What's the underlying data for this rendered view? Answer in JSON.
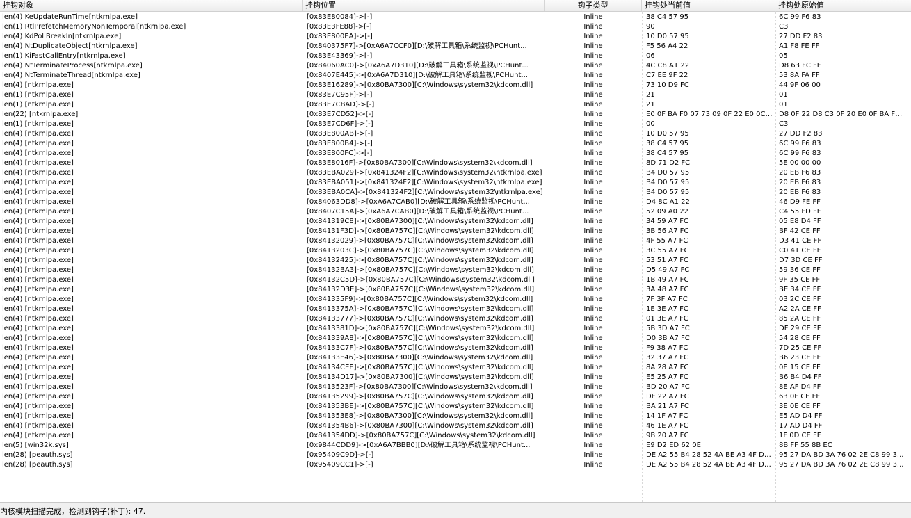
{
  "columns": [
    "挂钩对象",
    "挂钩位置",
    "钩子类型",
    "挂钩处当前值",
    "挂钩处原始值"
  ],
  "rows": [
    [
      "len(4) KeUpdateRunTime[ntkrnlpa.exe]",
      "[0x83E80084]->[-]",
      "Inline",
      "38 C4 57 95",
      "6C 99 F6 83"
    ],
    [
      "len(1) RtlPrefetchMemoryNonTemporal[ntkrnlpa.exe]",
      "[0x83E3FE88]->[-]",
      "Inline",
      "90",
      "C3"
    ],
    [
      "len(4) KdPollBreakIn[ntkrnlpa.exe]",
      "[0x83E800EA]->[-]",
      "Inline",
      "10 D0 57 95",
      "27 DD F2 83"
    ],
    [
      "len(4) NtDuplicateObject[ntkrnlpa.exe]",
      "[0x840375F7]->[0xA6A7CCF0][D:\\破解工具箱\\系统监视\\PCHunt...",
      "Inline",
      "F5 56 A4 22",
      "A1 F8 FE FF"
    ],
    [
      "len(1) KiFastCallEntry[ntkrnlpa.exe]",
      "[0x83E43369]->[-]",
      "Inline",
      "06",
      "05"
    ],
    [
      "len(4) NtTerminateProcess[ntkrnlpa.exe]",
      "[0x84060AC0]->[0xA6A7D310][D:\\破解工具箱\\系统监视\\PCHunt...",
      "Inline",
      "4C C8 A1 22",
      "D8 63 FC FF"
    ],
    [
      "len(4) NtTerminateThread[ntkrnlpa.exe]",
      "[0x8407E445]->[0xA6A7D310][D:\\破解工具箱\\系统监视\\PCHunt...",
      "Inline",
      "C7 EE 9F 22",
      "53 8A FA FF"
    ],
    [
      "len(4) [ntkrnlpa.exe]",
      "[0x83E16289]->[0x80BA7300][C:\\Windows\\system32\\kdcom.dll]",
      "Inline",
      "73 10 D9 FC",
      "44 9F 06 00"
    ],
    [
      "len(1) [ntkrnlpa.exe]",
      "[0x83E7C95F]->[-]",
      "Inline",
      "21",
      "01"
    ],
    [
      "len(1) [ntkrnlpa.exe]",
      "[0x83E7CBAD]->[-]",
      "Inline",
      "21",
      "01"
    ],
    [
      "len(22) [ntkrnlpa.exe]",
      "[0x83E7CD52]->[-]",
      "Inline",
      "E0 0F BA F0 07 73 09 0F 22 E0 0C ...",
      "D8 0F 22 D8 C3 0F 20 E0 0F BA F0..."
    ],
    [
      "len(1) [ntkrnlpa.exe]",
      "[0x83E7CD6F]->[-]",
      "Inline",
      "00",
      "C3"
    ],
    [
      "len(4) [ntkrnlpa.exe]",
      "[0x83E800AB]->[-]",
      "Inline",
      "10 D0 57 95",
      "27 DD F2 83"
    ],
    [
      "len(4) [ntkrnlpa.exe]",
      "[0x83E800B4]->[-]",
      "Inline",
      "38 C4 57 95",
      "6C 99 F6 83"
    ],
    [
      "len(4) [ntkrnlpa.exe]",
      "[0x83E800FC]->[-]",
      "Inline",
      "38 C4 57 95",
      "6C 99 F6 83"
    ],
    [
      "len(4) [ntkrnlpa.exe]",
      "[0x83E8016F]->[0x80BA7300][C:\\Windows\\system32\\kdcom.dll]",
      "Inline",
      "8D 71 D2 FC",
      "5E 00 00 00"
    ],
    [
      "len(4) [ntkrnlpa.exe]",
      "[0x83EBA029]->[0x841324F2][C:\\Windows\\system32\\ntkrnlpa.exe]",
      "Inline",
      "B4 D0 57 95",
      "20 EB F6 83"
    ],
    [
      "len(4) [ntkrnlpa.exe]",
      "[0x83EBA051]->[0x841324F2][C:\\Windows\\system32\\ntkrnlpa.exe]",
      "Inline",
      "B4 D0 57 95",
      "20 EB F6 83"
    ],
    [
      "len(4) [ntkrnlpa.exe]",
      "[0x83EBA0CA]->[0x841324F2][C:\\Windows\\system32\\ntkrnlpa.exe]",
      "Inline",
      "B4 D0 57 95",
      "20 EB F6 83"
    ],
    [
      "len(4) [ntkrnlpa.exe]",
      "[0x84063DD8]->[0xA6A7CAB0][D:\\破解工具箱\\系统监视\\PCHunt...",
      "Inline",
      "D4 8C A1 22",
      "46 D9 FE FF"
    ],
    [
      "len(4) [ntkrnlpa.exe]",
      "[0x8407C15A]->[0xA6A7CAB0][D:\\破解工具箱\\系统监视\\PCHunt...",
      "Inline",
      "52 09 A0 22",
      "C4 55 FD FF"
    ],
    [
      "len(4) [ntkrnlpa.exe]",
      "[0x841319C8]->[0x80BA7300][C:\\Windows\\system32\\kdcom.dll]",
      "Inline",
      "34 59 A7 FC",
      "05 E8 D4 FF"
    ],
    [
      "len(4) [ntkrnlpa.exe]",
      "[0x84131F3D]->[0x80BA757C][C:\\Windows\\system32\\kdcom.dll]",
      "Inline",
      "3B 56 A7 FC",
      "BF 42 CE FF"
    ],
    [
      "len(4) [ntkrnlpa.exe]",
      "[0x84132029]->[0x80BA757C][C:\\Windows\\system32\\kdcom.dll]",
      "Inline",
      "4F 55 A7 FC",
      "D3 41 CE FF"
    ],
    [
      "len(4) [ntkrnlpa.exe]",
      "[0x8413203C]->[0x80BA757C][C:\\Windows\\system32\\kdcom.dll]",
      "Inline",
      "3C 55 A7 FC",
      "C0 41 CE FF"
    ],
    [
      "len(4) [ntkrnlpa.exe]",
      "[0x84132425]->[0x80BA757C][C:\\Windows\\system32\\kdcom.dll]",
      "Inline",
      "53 51 A7 FC",
      "D7 3D CE FF"
    ],
    [
      "len(4) [ntkrnlpa.exe]",
      "[0x84132BA3]->[0x80BA757C][C:\\Windows\\system32\\kdcom.dll]",
      "Inline",
      "D5 49 A7 FC",
      "59 36 CE FF"
    ],
    [
      "len(4) [ntkrnlpa.exe]",
      "[0x84132C5D]->[0x80BA757C][C:\\Windows\\system32\\kdcom.dll]",
      "Inline",
      "1B 49 A7 FC",
      "9F 35 CE FF"
    ],
    [
      "len(4) [ntkrnlpa.exe]",
      "[0x84132D3E]->[0x80BA757C][C:\\Windows\\system32\\kdcom.dll]",
      "Inline",
      "3A 48 A7 FC",
      "BE 34 CE FF"
    ],
    [
      "len(4) [ntkrnlpa.exe]",
      "[0x841335F9]->[0x80BA757C][C:\\Windows\\system32\\kdcom.dll]",
      "Inline",
      "7F 3F A7 FC",
      "03 2C CE FF"
    ],
    [
      "len(4) [ntkrnlpa.exe]",
      "[0x8413375A]->[0x80BA757C][C:\\Windows\\system32\\kdcom.dll]",
      "Inline",
      "1E 3E A7 FC",
      "A2 2A CE FF"
    ],
    [
      "len(4) [ntkrnlpa.exe]",
      "[0x84133777]->[0x80BA757C][C:\\Windows\\system32\\kdcom.dll]",
      "Inline",
      "01 3E A7 FC",
      "85 2A CE FF"
    ],
    [
      "len(4) [ntkrnlpa.exe]",
      "[0x8413381D]->[0x80BA757C][C:\\Windows\\system32\\kdcom.dll]",
      "Inline",
      "5B 3D A7 FC",
      "DF 29 CE FF"
    ],
    [
      "len(4) [ntkrnlpa.exe]",
      "[0x841339A8]->[0x80BA757C][C:\\Windows\\system32\\kdcom.dll]",
      "Inline",
      "D0 3B A7 FC",
      "54 28 CE FF"
    ],
    [
      "len(4) [ntkrnlpa.exe]",
      "[0x84133C7F]->[0x80BA757C][C:\\Windows\\system32\\kdcom.dll]",
      "Inline",
      "F9 38 A7 FC",
      "7D 25 CE FF"
    ],
    [
      "len(4) [ntkrnlpa.exe]",
      "[0x84133E46]->[0x80BA7300][C:\\Windows\\system32\\kdcom.dll]",
      "Inline",
      "32 37 A7 FC",
      "B6 23 CE FF"
    ],
    [
      "len(4) [ntkrnlpa.exe]",
      "[0x84134CEE]->[0x80BA757C][C:\\Windows\\system32\\kdcom.dll]",
      "Inline",
      "8A 28 A7 FC",
      "0E 15 CE FF"
    ],
    [
      "len(4) [ntkrnlpa.exe]",
      "[0x84134D17]->[0x80BA7300][C:\\Windows\\system32\\kdcom.dll]",
      "Inline",
      "E5 25 A7 FC",
      "B6 B4 D4 FF"
    ],
    [
      "len(4) [ntkrnlpa.exe]",
      "[0x8413523F]->[0x80BA7300][C:\\Windows\\system32\\kdcom.dll]",
      "Inline",
      "BD 20 A7 FC",
      "8E AF D4 FF"
    ],
    [
      "len(4) [ntkrnlpa.exe]",
      "[0x84135299]->[0x80BA757C][C:\\Windows\\system32\\kdcom.dll]",
      "Inline",
      "DF 22 A7 FC",
      "63 0F CE FF"
    ],
    [
      "len(4) [ntkrnlpa.exe]",
      "[0x841353BE]->[0x80BA757C][C:\\Windows\\system32\\kdcom.dll]",
      "Inline",
      "BA 21 A7 FC",
      "3E 0E CE FF"
    ],
    [
      "len(4) [ntkrnlpa.exe]",
      "[0x841353E8]->[0x80BA7300][C:\\Windows\\system32\\kdcom.dll]",
      "Inline",
      "14 1F A7 FC",
      "E5 AD D4 FF"
    ],
    [
      "len(4) [ntkrnlpa.exe]",
      "[0x841354B6]->[0x80BA7300][C:\\Windows\\system32\\kdcom.dll]",
      "Inline",
      "46 1E A7 FC",
      "17 AD D4 FF"
    ],
    [
      "len(4) [ntkrnlpa.exe]",
      "[0x841354DD]->[0x80BA757C][C:\\Windows\\system32\\kdcom.dll]",
      "Inline",
      "9B 20 A7 FC",
      "1F 0D CE FF"
    ],
    [
      "len(5) [win32k.sys]",
      "[0x9844CDD9]->[0xA6A7BBB0][D:\\破解工具箱\\系统监视\\PCHunt...",
      "Inline",
      "E9 D2 ED 62 0E",
      "8B FF 55 8B EC"
    ],
    [
      "len(28) [peauth.sys]",
      "[0x95409C9D]->[-]",
      "Inline",
      "DE A2 55 B4 28 52 4A BE A3 4F DB...",
      "95 27 DA BD 3A 76 02 2E C8 99 3..."
    ],
    [
      "len(28) [peauth.sys]",
      "[0x95409CC1]->[-]",
      "Inline",
      "DE A2 55 B4 28 52 4A BE A3 4F DB...",
      "95 27 DA BD 3A 76 02 2E C8 99 3..."
    ]
  ],
  "status": {
    "text": "内核模块扫描完成，检测到钩子(补丁): 47."
  }
}
